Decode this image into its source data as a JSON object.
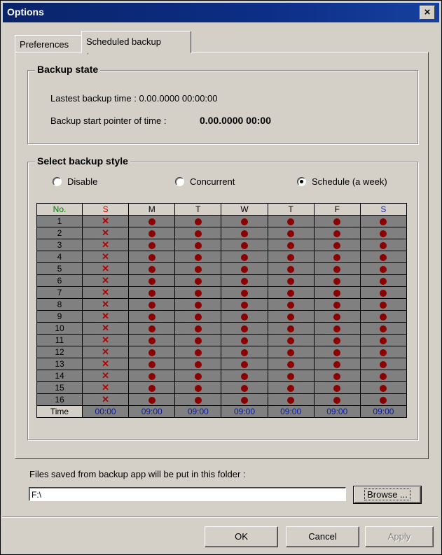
{
  "window": {
    "title": "Options",
    "close_glyph": "×"
  },
  "tabs": [
    {
      "label": "Preferences"
    },
    {
      "label": "Scheduled backup",
      "active": true
    }
  ],
  "backup_state": {
    "title": "Backup state",
    "latest_label": "Lastest backup time : 0.00.0000 00:00:00",
    "pointer_label": "Backup start pointer of time :",
    "pointer_value": "0.00.0000 00:00"
  },
  "backup_style": {
    "title": "Select backup style",
    "options": [
      {
        "label": "Disable",
        "selected": false
      },
      {
        "label": "Concurrent",
        "selected": false
      },
      {
        "label": "Schedule (a week)",
        "selected": true
      }
    ]
  },
  "schedule": {
    "header": [
      "No.",
      "S",
      "M",
      "T",
      "W",
      "T",
      "F",
      "S"
    ],
    "header_colors": [
      "#008000",
      "#d00000",
      "#000000",
      "#000000",
      "#000000",
      "#000000",
      "#000000",
      "#2030a0"
    ],
    "rows": [
      "1",
      "2",
      "3",
      "4",
      "5",
      "6",
      "7",
      "8",
      "9",
      "10",
      "11",
      "12",
      "13",
      "14",
      "15",
      "16"
    ],
    "day_marks": [
      "x",
      "dot",
      "dot",
      "dot",
      "dot",
      "dot",
      "dot"
    ],
    "time_label": "Time",
    "times": [
      "00:00",
      "09:00",
      "09:00",
      "09:00",
      "09:00",
      "09:00",
      "09:00"
    ]
  },
  "folder": {
    "label": "Files saved from backup app will be put in this folder :",
    "value": "F:\\",
    "browse_label": "Browse ..."
  },
  "buttons": {
    "ok": "OK",
    "cancel": "Cancel",
    "apply": "Apply"
  }
}
